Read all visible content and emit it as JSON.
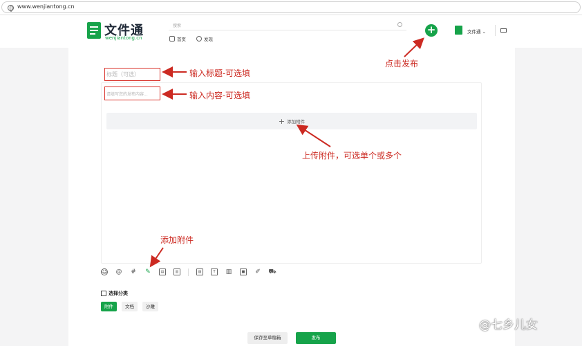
{
  "browser": {
    "url": "www.wenjiantong.cn"
  },
  "header": {
    "logo_title": "文件通",
    "logo_sub": "wenjiantong.cn",
    "search_placeholder": "搜索",
    "nav": [
      {
        "label": "首页"
      },
      {
        "label": "发现"
      }
    ],
    "publish_icon": "+",
    "user_name": "文件通",
    "colors": {
      "brand": "#16a34a"
    }
  },
  "editor": {
    "title_placeholder": "标题（可选）",
    "content_placeholder": "请填写您的发布内容...",
    "attach_label": "添加附件"
  },
  "toolbar": {
    "icons": [
      "emoji-icon",
      "mention-icon",
      "hashtag-icon",
      "attachment-icon",
      "document-icon",
      "files-icon",
      "image-icon",
      "text-icon",
      "chart-icon",
      "media-icon",
      "edit-icon",
      "cart-icon"
    ]
  },
  "category": {
    "title": "选择分类",
    "options": [
      {
        "label": "附件",
        "selected": true
      },
      {
        "label": "文档",
        "selected": false
      },
      {
        "label": "沙雕",
        "selected": false
      }
    ]
  },
  "actions": {
    "save_draft": "保存至草稿箱",
    "publish": "发布"
  },
  "annotations": {
    "title": "输入标题-可选填",
    "content": "输入内容-可选填",
    "upload": "上传附件，可选单个或多个",
    "publish": "点击发布",
    "attach": "添加附件",
    "color": "#cc2a22"
  },
  "watermark": "@七乡儿女"
}
